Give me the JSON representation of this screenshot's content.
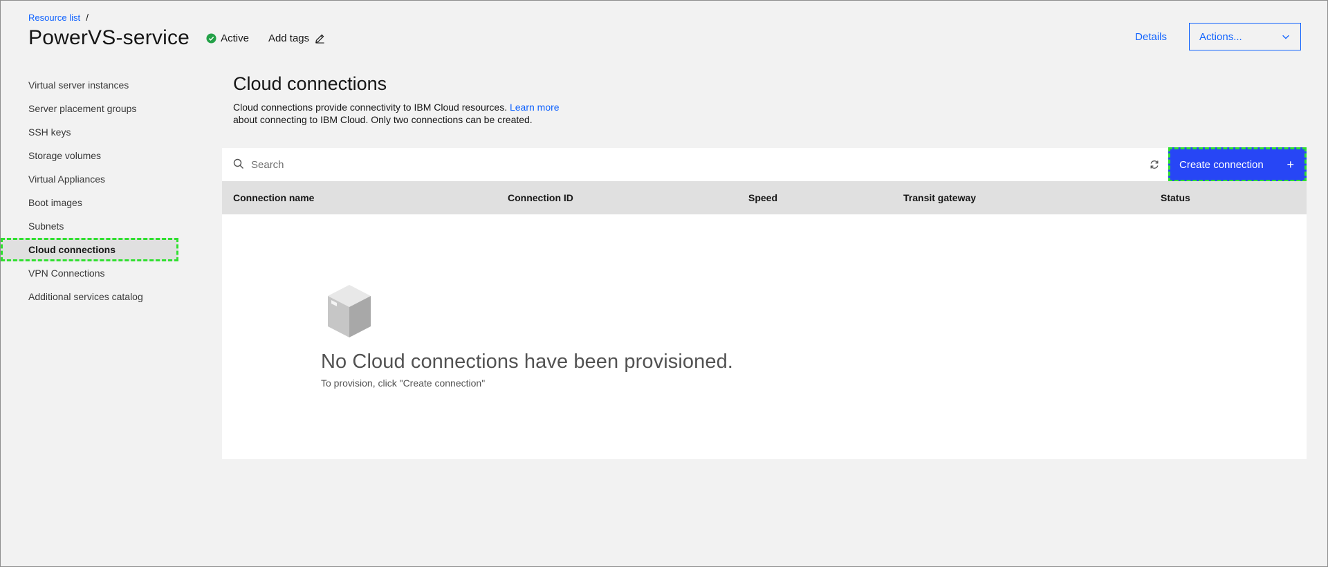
{
  "breadcrumb": {
    "items": [
      "Resource list"
    ],
    "separator": "/"
  },
  "header": {
    "title": "PowerVS-service",
    "status": {
      "label": "Active",
      "icon": "checkmark-filled-icon",
      "color": "#24a148"
    },
    "add_tags_label": "Add tags",
    "add_tags_icon": "edit-icon",
    "details_label": "Details",
    "actions_label": "Actions...",
    "actions_icon": "chevron-down-icon"
  },
  "sidebar": {
    "items": [
      {
        "label": "Virtual server instances",
        "active": false
      },
      {
        "label": "Server placement groups",
        "active": false
      },
      {
        "label": "SSH keys",
        "active": false
      },
      {
        "label": "Storage volumes",
        "active": false
      },
      {
        "label": "Virtual Appliances",
        "active": false
      },
      {
        "label": "Boot images",
        "active": false
      },
      {
        "label": "Subnets",
        "active": false
      },
      {
        "label": "Cloud connections",
        "active": true
      },
      {
        "label": "VPN Connections",
        "active": false
      },
      {
        "label": "Additional services catalog",
        "active": false
      }
    ]
  },
  "main": {
    "title": "Cloud connections",
    "description_text": "Cloud connections provide connectivity to IBM Cloud resources. ",
    "description_link": "Learn more",
    "description_rest": "about connecting to IBM Cloud. Only two connections can be created.",
    "search": {
      "placeholder": "Search",
      "value": ""
    },
    "create_button_label": "Create connection",
    "create_button_icon": "add-icon",
    "refresh_icon": "renew-icon",
    "table": {
      "columns": [
        "Connection name",
        "Connection ID",
        "Speed",
        "Transit gateway",
        "Status"
      ],
      "rows": []
    },
    "empty_state": {
      "icon": "empty-box-icon",
      "title": "No Cloud connections have been provisioned.",
      "subtitle": "To provision, click \"Create connection\""
    }
  },
  "colors": {
    "accent": "#0f62fe",
    "primary_button": "#2746f5",
    "highlight_outline": "#2fe02f",
    "background": "#f2f2f2",
    "table_header": "#e0e0e0"
  }
}
